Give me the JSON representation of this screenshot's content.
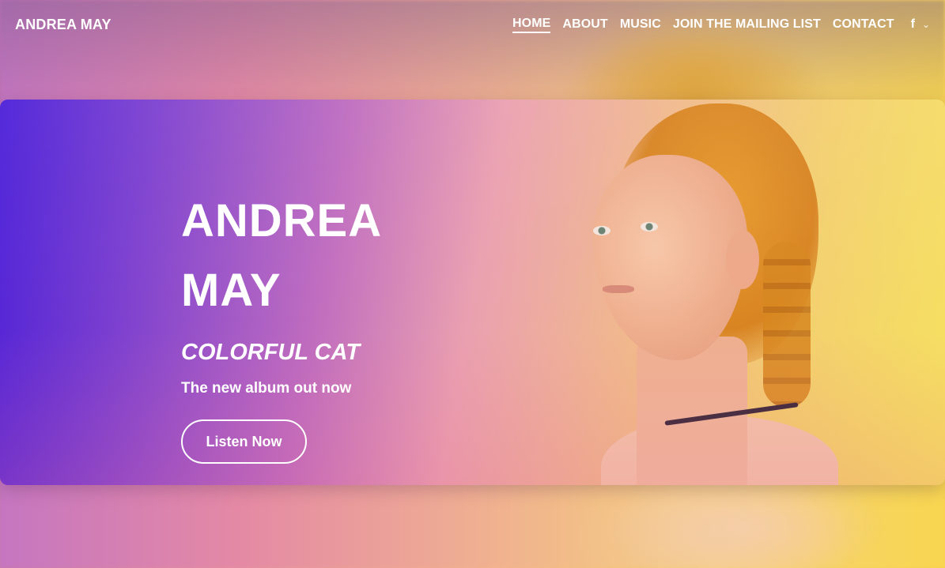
{
  "brand": "ANDREA MAY",
  "nav": {
    "items": [
      {
        "label": "HOME",
        "active": true
      },
      {
        "label": "ABOUT",
        "active": false
      },
      {
        "label": "MUSIC",
        "active": false
      },
      {
        "label": "JOIN THE MAILING LIST",
        "active": false
      },
      {
        "label": "CONTACT",
        "active": false
      }
    ],
    "social_icon": "facebook-icon",
    "social_glyph": "f",
    "more_icon": "chevron-down-icon",
    "more_glyph": "⌄"
  },
  "hero": {
    "title_line1": "ANDREA",
    "title_line2": "MAY",
    "subtitle": "COLORFUL CAT",
    "tagline": "The new album out now",
    "button_label": "Listen Now"
  },
  "colors": {
    "gradient_start": "#4b1fd8",
    "gradient_mid": "#eaa0b0",
    "gradient_end": "#f6e160",
    "text": "#ffffff"
  }
}
